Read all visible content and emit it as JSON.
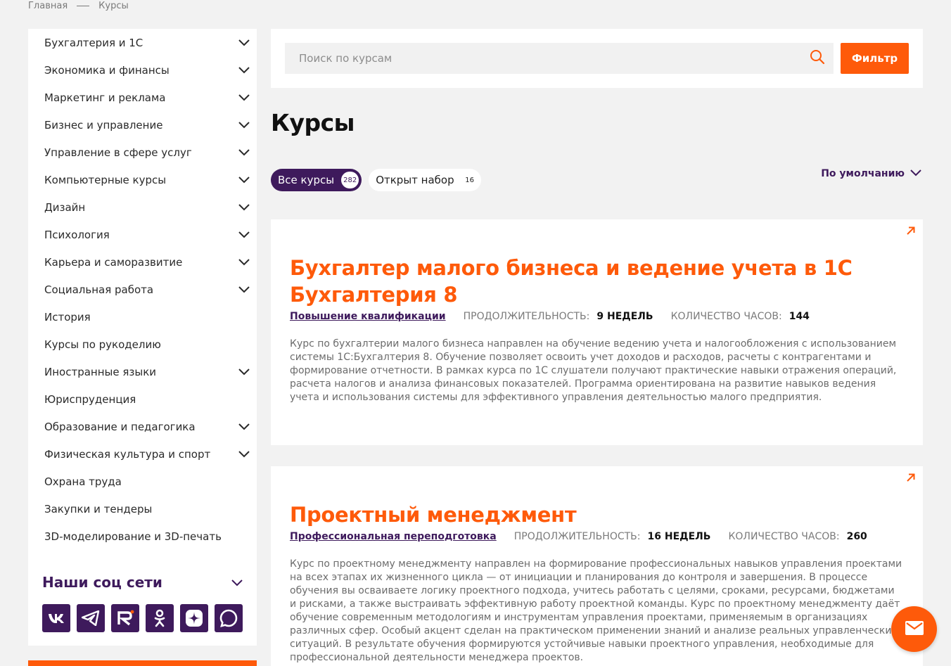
{
  "breadcrumb": {
    "home": "Главная",
    "current": "Курсы"
  },
  "sidebar": {
    "categories": [
      {
        "label": "Бухгалтерия и 1С",
        "expandable": true
      },
      {
        "label": "Экономика и финансы",
        "expandable": true
      },
      {
        "label": "Маркетинг и реклама",
        "expandable": true
      },
      {
        "label": "Бизнес и управление",
        "expandable": true
      },
      {
        "label": "Управление в сфере услуг",
        "expandable": true
      },
      {
        "label": "Компьютерные курсы",
        "expandable": true
      },
      {
        "label": "Дизайн",
        "expandable": true
      },
      {
        "label": "Психология",
        "expandable": true
      },
      {
        "label": "Карьера и саморазвитие",
        "expandable": true
      },
      {
        "label": "Социальная работа",
        "expandable": true
      },
      {
        "label": "История",
        "expandable": false
      },
      {
        "label": "Курсы по рукоделию",
        "expandable": false
      },
      {
        "label": "Иностранные языки",
        "expandable": true
      },
      {
        "label": "Юриспруденция",
        "expandable": false
      },
      {
        "label": "Образование и педагогика",
        "expandable": true
      },
      {
        "label": "Физическая культура и спорт",
        "expandable": true
      },
      {
        "label": "Охрана труда",
        "expandable": false
      },
      {
        "label": "Закупки и тендеры",
        "expandable": false
      },
      {
        "label": "3D-моделирование и 3D-печать",
        "expandable": false
      }
    ],
    "social_title": "Наши соц сети",
    "social_icons": [
      "vk-icon",
      "telegram-icon",
      "rutube-icon",
      "odnoklassniki-icon",
      "dzen-icon",
      "max-icon"
    ]
  },
  "search": {
    "placeholder": "Поиск по курсам",
    "value": "",
    "filter_label": "Фильтр"
  },
  "page_title": "Курсы",
  "tabs": [
    {
      "label": "Все курсы",
      "count": "282",
      "active": true
    },
    {
      "label": "Открыт набор",
      "count": "16",
      "active": false
    }
  ],
  "sort": {
    "label": "По умолчанию"
  },
  "courses": [
    {
      "title": "Бухгалтер малого бизнеса и ведение учета в 1С Бухгалтерия 8",
      "type": "Повышение квалификации",
      "duration_label": "Продолжительность:",
      "duration": "9 недель",
      "hours_label": "Количество часов:",
      "hours": "144",
      "description": "Курс по бухгалтерии малого бизнеса направлен на обучение ведению учета и налогообложения с использованием системы 1С:Бухгалтерия 8. Обучение позволяет освоить учет доходов и расходов, расчеты с контрагентами и формирование отчетности. В рамках курса по 1С слушатели получают практические навыки отражения операций, расчета налогов и анализа финансовых показателей. Программа ориентирована на развитие навыков ведения учета и использования системы для эффективного управления деятельностью малого предприятия."
    },
    {
      "title": "Проектный менеджмент",
      "type": "Профессиональная переподготовка",
      "duration_label": "Продолжительность:",
      "duration": "16 недель",
      "hours_label": "Количество часов:",
      "hours": "260",
      "description": "Курс по проектному менеджменту направлен на формирование профессиональных навыков управления проектами на всех этапах их жизненного цикла — от инициации и планирования до контроля и завершения. В процессе обучения вы осваиваете логику проектного подхода, учитесь работать с целями, сроками, ресурсами, бюджетами и рисками, а также выстраивать эффективную работу проектной команды. Курс по проектному менеджменту даёт обучение современным методологиям и инструментам управления проектами, применяемым в организациях различных сфер. Особый акцент сделан на практическом применении знаний и анализе реальных управленческих ситуаций. В результате обучения формируются устойчивые навыки проектного управления, необходимые для профессиональной деятельности менеджера проектов."
    }
  ],
  "colors": {
    "accent": "#fe5a0a",
    "brand": "#3e1a5c",
    "background": "#f2f2f2"
  }
}
